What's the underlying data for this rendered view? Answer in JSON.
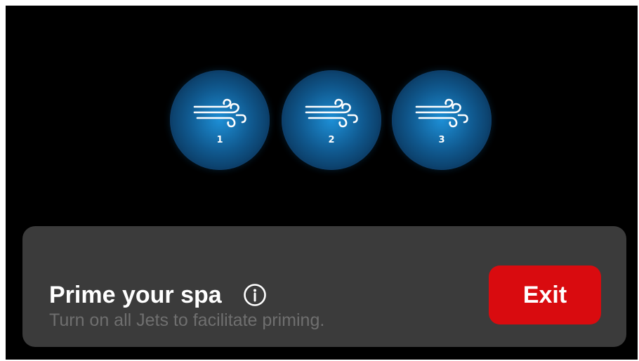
{
  "jets": [
    {
      "label": "1",
      "icon": "wind-icon"
    },
    {
      "label": "2",
      "icon": "wind-icon"
    },
    {
      "label": "3",
      "icon": "wind-icon"
    }
  ],
  "panel": {
    "title": "Prime your spa",
    "subtitle": "Turn on all Jets to facilitate priming.",
    "info_icon": "info-icon",
    "exit_label": "Exit"
  },
  "colors": {
    "background": "#000000",
    "panel": "#3b3b3b",
    "jet_blue": "#1d8fd6",
    "exit_red": "#d90b0f",
    "subtitle_gray": "#6f6f6f"
  }
}
